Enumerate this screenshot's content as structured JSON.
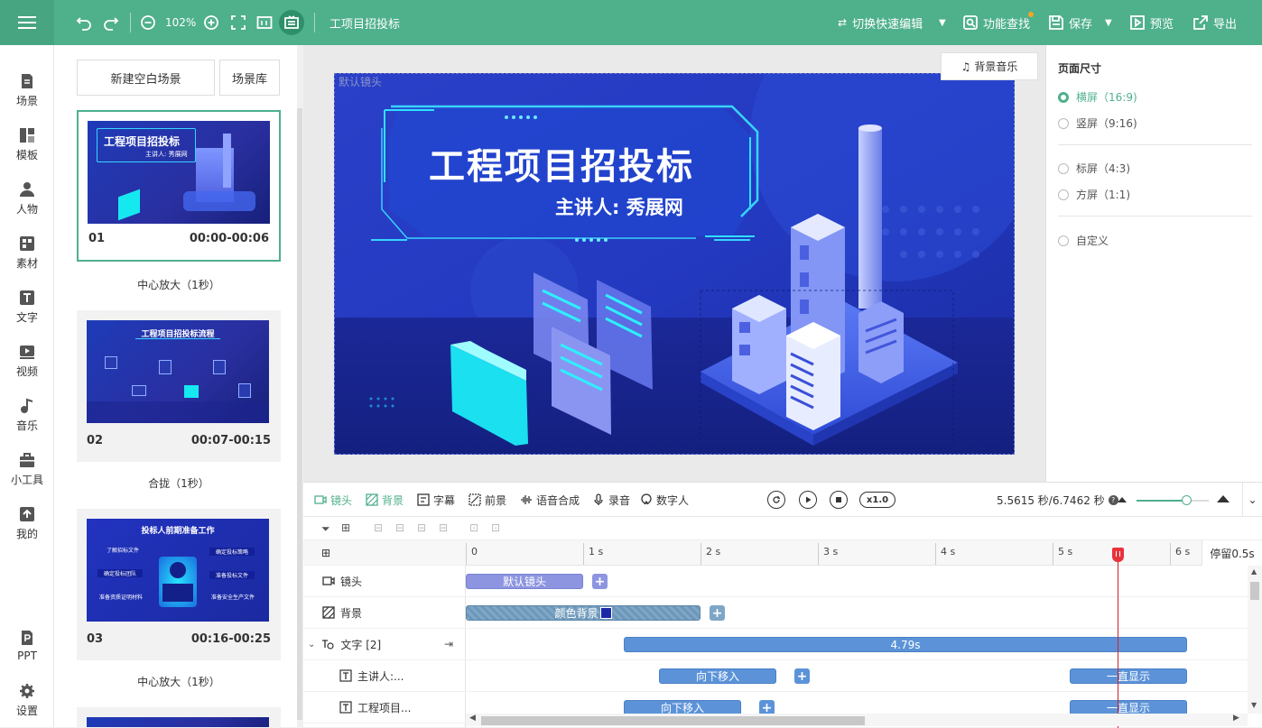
{
  "topbar": {
    "zoom": "102%",
    "project_title": "工项目招投标",
    "switch_edit": "切换快速编辑",
    "feature_search": "功能查找",
    "save": "保存",
    "preview": "预览",
    "export": "导出"
  },
  "leftnav": {
    "items": [
      {
        "label": "场景",
        "icon": "scene-icon"
      },
      {
        "label": "模板",
        "icon": "template-icon"
      },
      {
        "label": "人物",
        "icon": "person-icon"
      },
      {
        "label": "素材",
        "icon": "material-icon"
      },
      {
        "label": "文字",
        "icon": "text-icon"
      },
      {
        "label": "视频",
        "icon": "video-icon"
      },
      {
        "label": "音乐",
        "icon": "music-icon"
      },
      {
        "label": "小工具",
        "icon": "toolbox-icon"
      },
      {
        "label": "我的",
        "icon": "my-icon"
      },
      {
        "label": "PPT",
        "icon": "ppt-icon"
      },
      {
        "label": "设置",
        "icon": "settings-icon"
      }
    ]
  },
  "scenes": {
    "new_blank": "新建空白场景",
    "library": "场景库",
    "cards": [
      {
        "num": "01",
        "time": "00:00-00:06",
        "thumb_title": "工程项目招投标",
        "thumb_sub": "主讲人: 秀展网",
        "transition": "中心放大（1秒）"
      },
      {
        "num": "02",
        "time": "00:07-00:15",
        "thumb_title": "工程项目招投标流程",
        "thumb_sub": "",
        "transition": "合拢（1秒）"
      },
      {
        "num": "03",
        "time": "00:16-00:25",
        "thumb_title": "投标人前期准备工作",
        "thumb_sub": "",
        "transition": "中心放大（1秒）"
      }
    ],
    "card3_items": [
      "了解招标文件",
      "确定投标策略",
      "确定投标团队",
      "准备投标文件",
      "准备资质证明材料",
      "准备安全生产文件"
    ]
  },
  "canvas": {
    "lens_label": "默认镜头",
    "bgm_button": "背景音乐",
    "slide_title": "工程项目招投标",
    "slide_subtitle": "主讲人: 秀展网"
  },
  "rightpanel": {
    "title": "页面尺寸",
    "options": [
      {
        "label": "横屏（16:9)",
        "selected": true
      },
      {
        "label": "竖屏（9:16)",
        "selected": false
      },
      {
        "label": "标屏（4:3)",
        "selected": false
      },
      {
        "label": "方屏（1:1)",
        "selected": false
      },
      {
        "label": "自定义",
        "selected": false
      }
    ]
  },
  "timeline": {
    "tabs": [
      {
        "label": "镜头",
        "icon": "camera-icon",
        "active": true
      },
      {
        "label": "背景",
        "icon": "background-icon",
        "active": true
      },
      {
        "label": "字幕",
        "icon": "subtitle-icon",
        "active": false
      },
      {
        "label": "前景",
        "icon": "foreground-icon",
        "active": false
      },
      {
        "label": "语音合成",
        "icon": "tts-icon",
        "active": false
      },
      {
        "label": "录音",
        "icon": "mic-icon",
        "active": false
      },
      {
        "label": "数字人",
        "icon": "avatar-icon",
        "active": false
      }
    ],
    "speed": "x1.0",
    "time_readout": "5.5615 秒/6.7462 秒",
    "zoom_fraction": 0.7,
    "ticks": [
      "0",
      "1 s",
      "2 s",
      "3 s",
      "4 s",
      "5 s",
      "6 s"
    ],
    "stay": "停留0.5s",
    "playhead_seconds": 5.5615,
    "tracks": [
      {
        "label": "镜头",
        "icon": "camera-icon"
      },
      {
        "label": "背景",
        "icon": "background-icon"
      },
      {
        "label": "文字 [2]",
        "icon": "text-group-icon"
      },
      {
        "label": "主讲人:...",
        "icon": "text-icon"
      },
      {
        "label": "工程项目...",
        "icon": "text-icon"
      }
    ],
    "clips": {
      "lens": "默认镜头",
      "background": "颜色背景",
      "text_group": "4.79s",
      "speaker_in": "向下移入",
      "speaker_stay": "一直显示",
      "title_in": "向下移入",
      "title_stay": "一直显示"
    }
  }
}
